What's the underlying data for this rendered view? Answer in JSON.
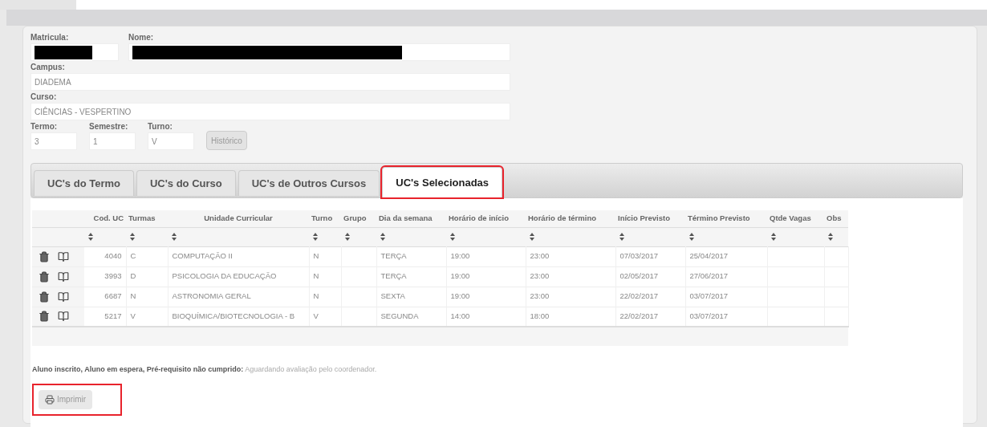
{
  "form": {
    "matricula": {
      "label": "Matricula:",
      "redacted": true
    },
    "nome": {
      "label": "Nome:",
      "redacted": true
    },
    "campus": {
      "label": "Campus:",
      "value": "DIADEMA"
    },
    "curso": {
      "label": "Curso:",
      "value": "CIÊNCIAS - VESPERTINO"
    },
    "small_fields": [
      {
        "label": "Termo:",
        "value": "3"
      },
      {
        "label": "Semestre:",
        "value": "1"
      },
      {
        "label": "Turno:",
        "value": "V"
      }
    ],
    "history_button": "Histórico"
  },
  "tabs": [
    {
      "label": "UC's do Termo",
      "selected": false,
      "highlighted": false
    },
    {
      "label": "UC's do Curso",
      "selected": false,
      "highlighted": false
    },
    {
      "label": "UC's de Outros Cursos",
      "selected": false,
      "highlighted": false
    },
    {
      "label": "UC's Selecionadas",
      "selected": true,
      "highlighted": true
    }
  ],
  "table": {
    "columns": [
      {
        "label": "Cod. UC",
        "sortable": true
      },
      {
        "label": "Turmas",
        "sortable": true
      },
      {
        "label": "Unidade Curricular",
        "sortable": true
      },
      {
        "label": "Turno",
        "sortable": true
      },
      {
        "label": "Grupo",
        "sortable": true
      },
      {
        "label": "Dia da semana",
        "sortable": true
      },
      {
        "label": "Horário de início",
        "sortable": true
      },
      {
        "label": "Horário de término",
        "sortable": true
      },
      {
        "label": "Início Previsto",
        "sortable": true
      },
      {
        "label": "Término Previsto",
        "sortable": true
      },
      {
        "label": "Qtde Vagas",
        "sortable": true
      },
      {
        "label": "Obs",
        "sortable": true
      }
    ],
    "rows": [
      {
        "cells": [
          "4040",
          "C",
          "COMPUTAÇÃO II",
          "N",
          "",
          "TERÇA",
          "19:00",
          "23:00",
          "07/03/2017",
          "25/04/2017",
          "",
          ""
        ]
      },
      {
        "cells": [
          "3993",
          "D",
          "PSICOLOGIA DA EDUCAÇÃO",
          "N",
          "",
          "TERÇA",
          "19:00",
          "23:00",
          "02/05/2017",
          "27/06/2017",
          "",
          ""
        ]
      },
      {
        "cells": [
          "6687",
          "N",
          "ASTRONOMIA GERAL",
          "N",
          "",
          "SEXTA",
          "19:00",
          "23:00",
          "22/02/2017",
          "03/07/2017",
          "",
          ""
        ]
      },
      {
        "cells": [
          "5217",
          "V",
          "BIOQUÍMICA/BIOTECNOLOGIA - B",
          "V",
          "",
          "SEGUNDA",
          "14:00",
          "18:00",
          "22/02/2017",
          "03/07/2017",
          "",
          ""
        ]
      }
    ]
  },
  "note": "**Aluno inscrito, Aluno em espera, Pré-requisito não cumprido:** Aguardando avaliação pelo coordenador.",
  "print_button": {
    "label": "Imprimir",
    "highlighted": true
  }
}
